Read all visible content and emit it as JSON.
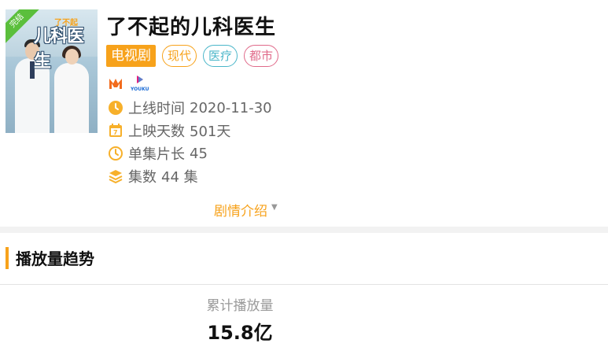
{
  "show": {
    "title": "了不起的儿科医生",
    "poster_badge": "完结",
    "poster_title": "儿科医生",
    "poster_subtitle": "了不起"
  },
  "tags": {
    "main": "电视剧",
    "items": [
      {
        "label": "现代",
        "color": "#f7a21b"
      },
      {
        "label": "医疗",
        "color": "#4ab6c9"
      },
      {
        "label": "都市",
        "color": "#e06a8a"
      }
    ]
  },
  "platforms": [
    {
      "icon": "mgtv-icon",
      "color": "#f26b1d"
    },
    {
      "icon": "youku-icon",
      "color": "#e2207f",
      "text": "YOUKU"
    }
  ],
  "info": {
    "launch_label": "上线时间",
    "launch_value": "2020-11-30",
    "days_label": "上映天数",
    "days_value": "501天",
    "duration_label": "单集片长",
    "duration_value": "45",
    "episodes_label": "集数",
    "episodes_value": "44 集"
  },
  "intro_label": "剧情介绍",
  "trend": {
    "title": "播放量趋势",
    "stat_label": "累计播放量",
    "stat_value": "15.8亿"
  },
  "colors": {
    "accent": "#f7a21b",
    "divider": "#f2f2f2"
  }
}
